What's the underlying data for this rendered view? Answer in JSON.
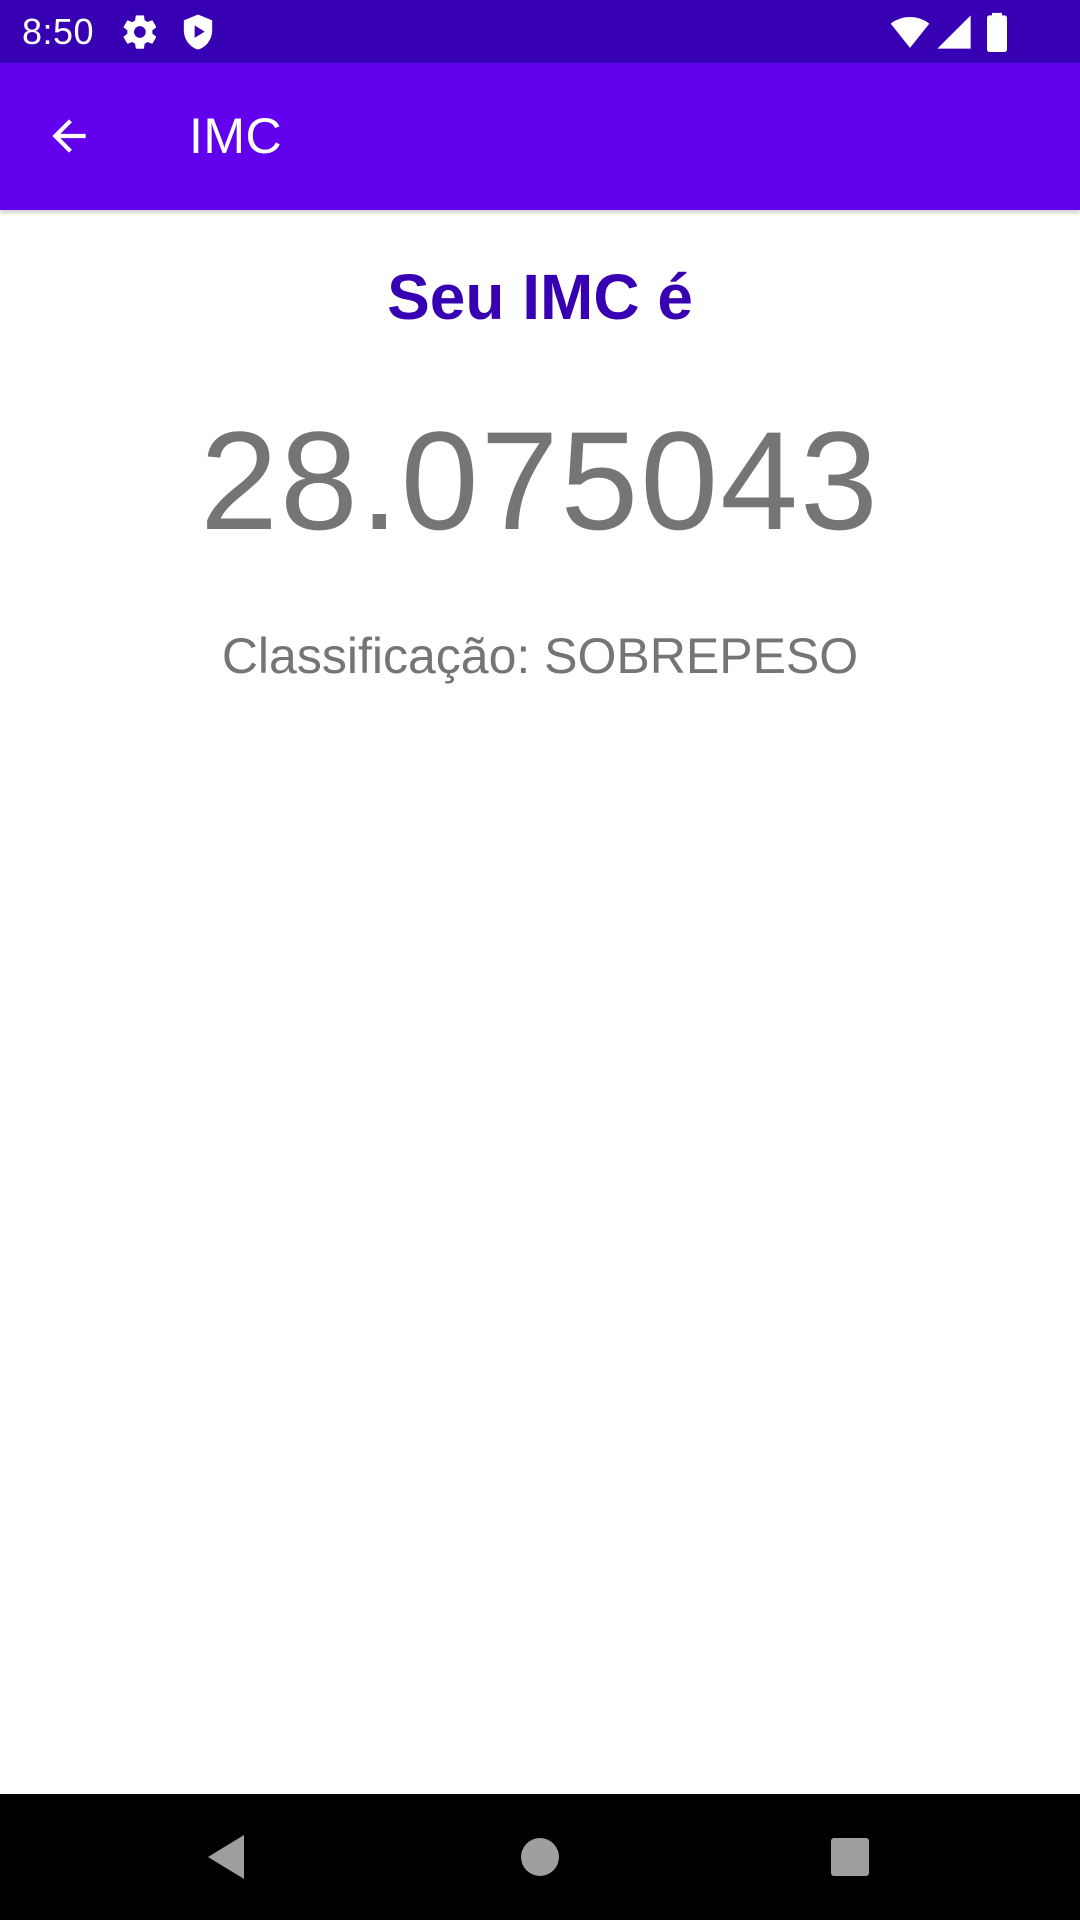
{
  "status_bar": {
    "time": "8:50",
    "icons": [
      "gear-icon",
      "shield-play-icon",
      "wifi-icon",
      "cellular-signal-icon",
      "battery-icon"
    ]
  },
  "app_bar": {
    "title": "IMC",
    "back_icon": "arrow-back-icon"
  },
  "result": {
    "heading": "Seu IMC é",
    "value": "28.075043",
    "classification": "Classificação: SOBREPESO"
  },
  "nav_bar": {
    "icons": [
      "back-triangle-icon",
      "home-circle-icon",
      "recents-square-icon"
    ]
  },
  "colors": {
    "status_bar": "#3700B3",
    "app_bar": "#6200EE",
    "heading": "#3700B3",
    "value_text": "#757575",
    "nav_bar": "#000000"
  }
}
